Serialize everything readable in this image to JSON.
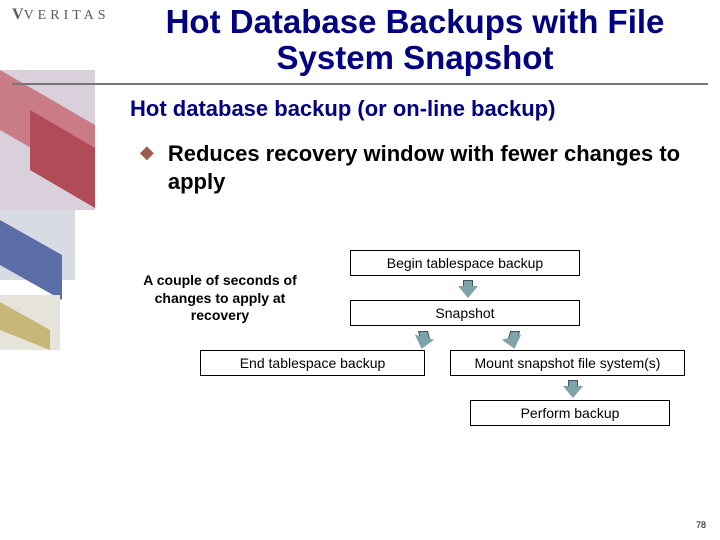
{
  "logo": {
    "text": "VERITAS"
  },
  "title": "Hot Database Backups with File System Snapshot",
  "subtitle": "Hot database backup (or on-line backup)",
  "bullet": {
    "marker": "◆",
    "text": "Reduces recovery window with fewer changes to apply"
  },
  "diagram": {
    "caption": "A couple of seconds of changes to apply at recovery",
    "box_begin": "Begin tablespace backup",
    "box_snapshot": "Snapshot",
    "box_end": "End tablespace backup",
    "box_mount": "Mount snapshot file system(s)",
    "box_perform": "Perform backup"
  },
  "page_number": "78"
}
